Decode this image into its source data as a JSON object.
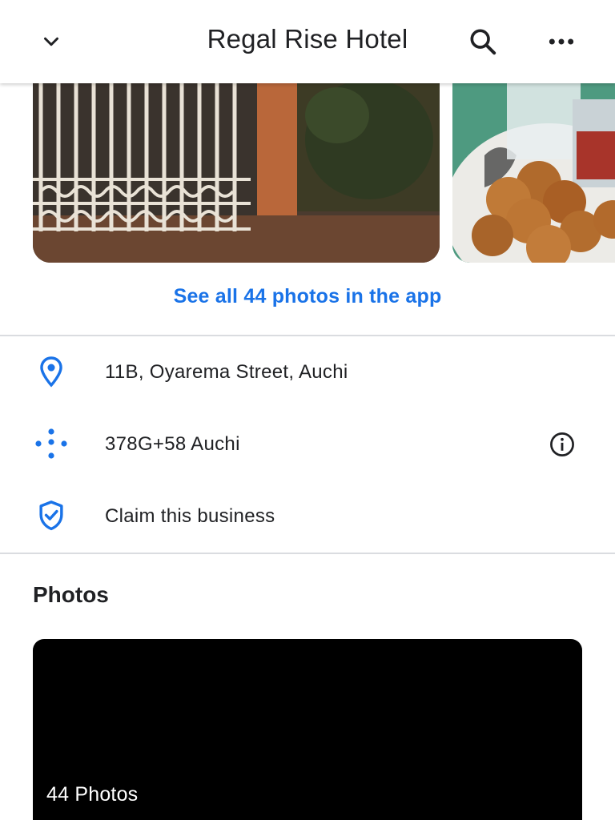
{
  "app": {
    "title": "Regal Rise Hotel",
    "accent_color": "#1a73e8"
  },
  "toolbar": {
    "back_icon": "chevron-down-icon",
    "search_icon": "search-icon",
    "more_icon": "more-horizontal-icon"
  },
  "carousel": {
    "photos": [
      {
        "subject": "gate"
      },
      {
        "subject": "food"
      }
    ]
  },
  "see_all_link": "See all 44 photos in the app",
  "details": {
    "address": {
      "icon": "location-pin-icon",
      "text": "11B, Oyarema Street, Auchi"
    },
    "plus_code": {
      "icon": "plus-code-icon",
      "text": "378G+58 Auchi",
      "info_icon": "info-icon"
    },
    "claim": {
      "icon": "shield-check-icon",
      "text": "Claim this business"
    }
  },
  "photos_section": {
    "title": "Photos",
    "count_label": "44 Photos"
  }
}
